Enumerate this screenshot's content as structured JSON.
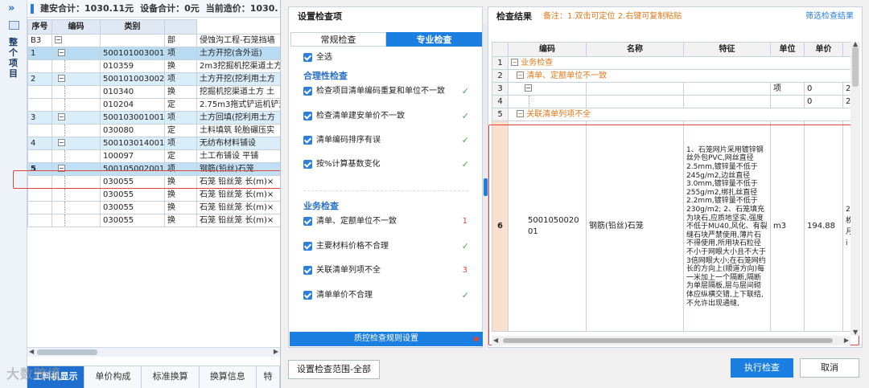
{
  "left_panel": {
    "vertical_label": "整个项目",
    "status": {
      "build_total": "建安合计：1030.11元",
      "equip_total": "设备合计：0元",
      "current_cost": "当前造价：1030."
    },
    "columns": [
      "序号",
      "编码",
      "类别",
      ""
    ],
    "rows": [
      {
        "seq": "B3",
        "code": "",
        "type": "部",
        "name": "侵蚀沟工程-石笼挡墙",
        "style": "plain",
        "level": 0
      },
      {
        "seq": "1",
        "code": "500101003001",
        "type": "项",
        "name": "土方开挖(含外运)",
        "style": "blue",
        "level": 1
      },
      {
        "seq": "",
        "code": "010359",
        "type": "换",
        "name": "2m3挖掘机挖渠道土方",
        "style": "plain",
        "level": 2
      },
      {
        "seq": "2",
        "code": "500101003002",
        "type": "项",
        "name": "土方开挖(挖利用土方",
        "style": "lightblue",
        "level": 1
      },
      {
        "seq": "",
        "code": "010340",
        "type": "换",
        "name": "挖掘机挖渠道土方 土",
        "style": "plain",
        "level": 2
      },
      {
        "seq": "",
        "code": "010204",
        "type": "定",
        "name": "2.75m3拖式铲运机铲运",
        "style": "plain",
        "level": 2
      },
      {
        "seq": "3",
        "code": "500103001001",
        "type": "项",
        "name": "土方回填(挖利用土方",
        "style": "lightblue",
        "level": 1
      },
      {
        "seq": "",
        "code": "030080",
        "type": "定",
        "name": "土料填筑 轮胎碾压实",
        "style": "plain",
        "level": 2
      },
      {
        "seq": "4",
        "code": "500103014001",
        "type": "项",
        "name": "无纺布材料铺设",
        "style": "lightblue",
        "level": 1
      },
      {
        "seq": "",
        "code": "100097",
        "type": "定",
        "name": "土工布铺设 平铺",
        "style": "plain",
        "level": 2
      },
      {
        "seq": "5",
        "code": "500105002001",
        "type": "项",
        "name": "钢筋(铅丝)石笼",
        "style": "sel",
        "level": 1
      },
      {
        "seq": "",
        "code": "030055",
        "type": "换",
        "name": "石笼 铅丝笼 长(m)×",
        "style": "plain",
        "level": 2
      },
      {
        "seq": "",
        "code": "030055",
        "type": "换",
        "name": "石笼 铅丝笼 长(m)×",
        "style": "plain",
        "level": 2
      },
      {
        "seq": "",
        "code": "030055",
        "type": "换",
        "name": "石笼 铅丝笼 长(m)×",
        "style": "plain",
        "level": 2
      },
      {
        "seq": "",
        "code": "030055",
        "type": "换",
        "name": "石笼 铅丝笼 长(m)×",
        "style": "plain",
        "level": 2
      }
    ],
    "bottom_tabs": [
      "工料机显示",
      "单价构成",
      "标准换算",
      "换算信息",
      "特"
    ],
    "watermark": "大数跨境"
  },
  "dialog": {
    "settings_title": "设置检查项",
    "tabs": [
      "常规检查",
      "专业检查"
    ],
    "select_all": "全选",
    "section1": "合理性检查",
    "section1_items": [
      {
        "label": "检查项目清单编码重复和单位不一致",
        "mark": "✓"
      },
      {
        "label": "检查清单建安单价不一致",
        "mark": "✓"
      },
      {
        "label": "清单编码排序有误",
        "mark": "✓"
      },
      {
        "label": "按%计算基数变化",
        "mark": "✓"
      }
    ],
    "section2": "业务检查",
    "section2_items": [
      {
        "label": "清单、定额单位不一致",
        "count": "1"
      },
      {
        "label": "主要材料价格不合理",
        "mark": "✓"
      },
      {
        "label": "关联清单列项不全",
        "count": "3"
      },
      {
        "label": "清单单价不合理",
        "mark": "✓"
      }
    ],
    "qc_rules_button": "质控检查规则设置",
    "results_title": "检查结果",
    "results_note": "备注：1.双击可定位 2.右键可复制粘贴",
    "filter_link": "筛选检查结果",
    "result_columns": [
      "",
      "编码",
      "名称",
      "特征",
      "单位",
      "单价",
      ""
    ],
    "result_rows": [
      {
        "n": "1",
        "text": "业务检查"
      },
      {
        "n": "2",
        "text": "清单、定额单位不一致"
      },
      {
        "n": "3",
        "unit": "项",
        "price": "0",
        "extra": "2"
      },
      {
        "n": "4",
        "unit": "",
        "price": "0",
        "extra": "2"
      },
      {
        "n": "5",
        "text": "关联清单列项不全"
      }
    ],
    "big_row": {
      "n": "6",
      "code": "500105002001",
      "name": "钢筋(铅丝)石笼",
      "feature": "1、石笼网片采用镀锌钢丝外包PVC,网丝直径2.5mm,镀锌量不低于245g/m2,边丝直径3.0mm,镀锌量不低于255g/m2,绑扎丝直径2.2mm,镀锌量不低于230g/m2;\n2、石笼填充为块石,应质地坚实,强度不低于MU40,风化、有裂缝石块严禁使用,薄片石不得使用,所用块石粒径不小于网眼大小且不大于3倍网眼大小;在石笼网约长的方向上(顺道方向)每一米加上一个隔断,隔断为单层隔板,层与层间砌体应纵横交错,上下联结,不允许出现通缝,",
      "unit": "m3",
      "price": "194.88",
      "extra": "2 枚 月 i"
    },
    "scope_button": "设置检查范围-全部",
    "run_button": "执行检查",
    "cancel_button": "取消"
  }
}
